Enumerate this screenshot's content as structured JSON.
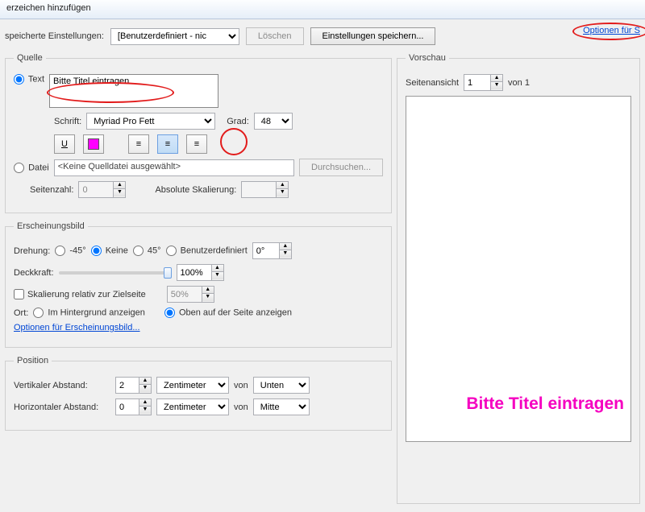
{
  "window": {
    "title": "erzeichen hinzufügen"
  },
  "toolbar": {
    "saved_label": "speicherte Einstellungen:",
    "preset": "[Benutzerdefiniert - nic",
    "delete": "Löschen",
    "save": "Einstellungen speichern...",
    "options": "Optionen für S"
  },
  "source": {
    "legend": "Quelle",
    "text_radio": "Text",
    "text_value": "Bitte Titel eintragen",
    "font_label": "Schrift:",
    "font": "Myriad Pro Fett",
    "size_label": "Grad:",
    "size": "48",
    "file_radio": "Datei",
    "file_value": "<Keine Quelldatei ausgewählt>",
    "browse": "Durchsuchen...",
    "pagecount_label": "Seitenzahl:",
    "pagecount": "0",
    "absscale_label": "Absolute Skalierung:",
    "absscale": ""
  },
  "appearance": {
    "legend": "Erscheinungsbild",
    "rotation_label": "Drehung:",
    "rot_m45": "-45°",
    "rot_none": "Keine",
    "rot_45": "45°",
    "rot_custom": "Benutzerdefiniert",
    "rot_val": "0°",
    "opacity_label": "Deckkraft:",
    "opacity": "100%",
    "scale_chk": "Skalierung relativ zur Zielseite",
    "scale_val": "50%",
    "place_label": "Ort:",
    "place_bg": "Im Hintergrund anzeigen",
    "place_fg": "Oben auf der Seite anzeigen",
    "opts_link": "Optionen für Erscheinungsbild..."
  },
  "position": {
    "legend": "Position",
    "v_label": "Vertikaler Abstand:",
    "v_val": "2",
    "v_unit": "Zentimeter",
    "v_from_lbl": "von",
    "v_from": "Unten",
    "h_label": "Horizontaler Abstand:",
    "h_val": "0",
    "h_unit": "Zentimeter",
    "h_from_lbl": "von",
    "h_from": "Mitte"
  },
  "preview": {
    "legend": "Vorschau",
    "pageview_label": "Seitenansicht",
    "page": "1",
    "of": "von 1",
    "watermark": "Bitte Titel eintragen"
  }
}
